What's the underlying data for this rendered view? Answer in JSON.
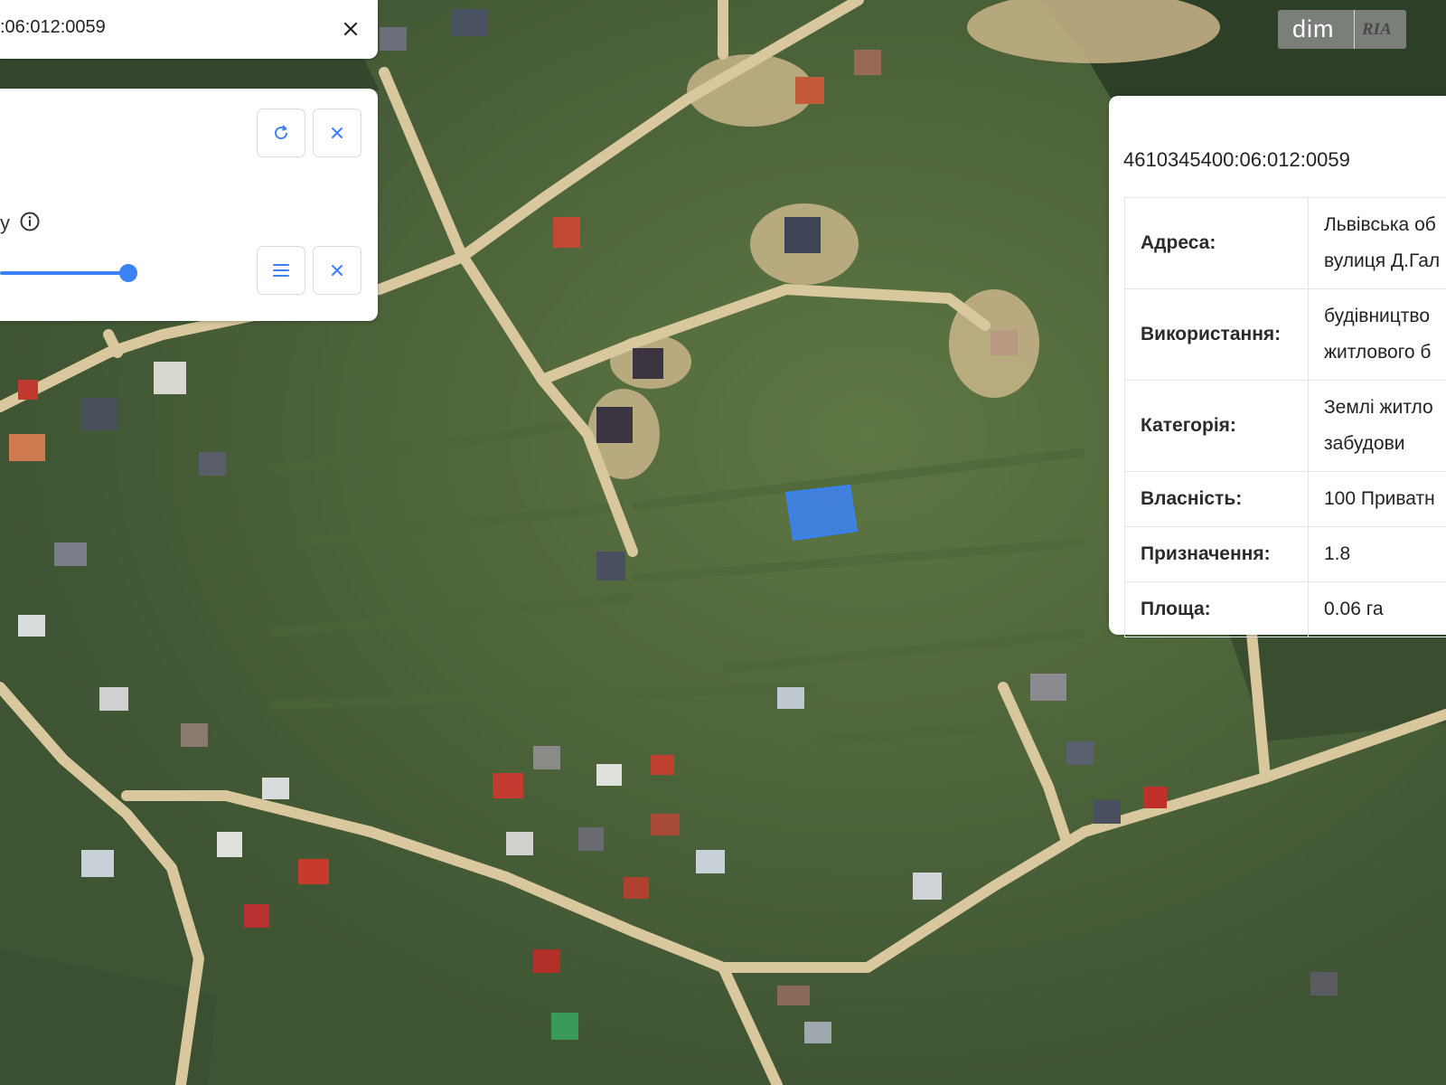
{
  "map": {
    "type": "satellite",
    "selected_parcel_color": "#3b82f6"
  },
  "search": {
    "value": ":06:012:0059",
    "close_icon": "close-icon"
  },
  "layers_panel": {
    "label_fragment": "у",
    "refresh_icon": "refresh-icon",
    "close_icon": "close-icon",
    "list_icon": "list-icon",
    "info_icon": "info-icon",
    "opacity_slider": {
      "value_fraction": 1.0
    }
  },
  "parcel_info": {
    "cadastral_number": "4610345400:06:012:0059",
    "rows": [
      {
        "key": "Адреса:",
        "value_lines": [
          "Львівська об",
          "вулиця Д.Гал"
        ]
      },
      {
        "key": "Використання:",
        "value_lines": [
          "будівництво",
          "житлового б"
        ]
      },
      {
        "key": "Категорія:",
        "value_lines": [
          "Землі житло",
          "забудови"
        ]
      },
      {
        "key": "Власність:",
        "value_lines": [
          "100 Приватн"
        ]
      },
      {
        "key": "Призначення:",
        "value_lines": [
          "1.8"
        ]
      },
      {
        "key": "Площа:",
        "value_lines": [
          "0.06 га"
        ]
      }
    ]
  },
  "watermark": {
    "text_left": "dim",
    "text_right": "RIA"
  },
  "colors": {
    "accent": "#3b82f6",
    "panel_bg": "#ffffff"
  }
}
